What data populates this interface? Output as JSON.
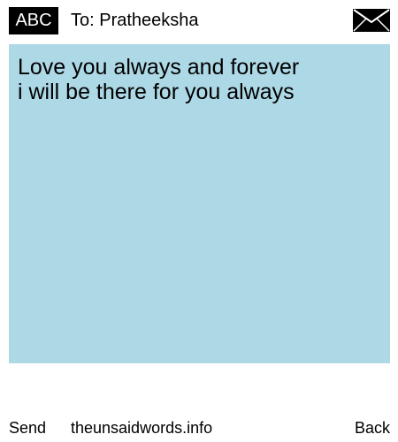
{
  "header": {
    "badge_label": "ABC",
    "to_label": "To: Pratheeksha",
    "mail_icon": "envelope-icon"
  },
  "message": {
    "lines": "Love you always and forever\ni will be there for you always",
    "background_color": "#add8e6"
  },
  "footer": {
    "send_label": "Send",
    "site_label": "theunsaidwords.info",
    "back_label": "Back"
  }
}
